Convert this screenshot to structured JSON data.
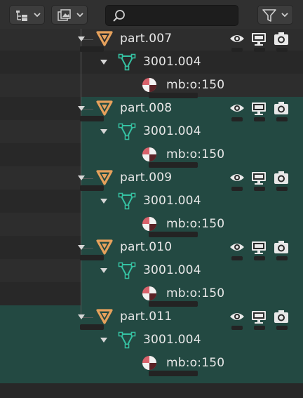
{
  "header": {
    "display_mode_icon": "outliner-tree-icon",
    "filter_icon": "filter-funnel-icon",
    "search": {
      "placeholder": "",
      "value": ""
    }
  },
  "colors": {
    "selected_row": "#234942",
    "object_icon": "#e6a15c",
    "mesh_icon": "#35c1a2",
    "material_icon": "#d9626c"
  },
  "objects": [
    {
      "name": "part.007",
      "mesh": "3001.004",
      "material": "mb:o:150",
      "selected": false
    },
    {
      "name": "part.008",
      "mesh": "3001.004",
      "material": "mb:o:150",
      "selected": true
    },
    {
      "name": "part.009",
      "mesh": "3001.004",
      "material": "mb:o:150",
      "selected": true
    },
    {
      "name": "part.010",
      "mesh": "3001.004",
      "material": "mb:o:150",
      "selected": true
    },
    {
      "name": "part.011",
      "mesh": "3001.004",
      "material": "mb:o:150",
      "selected": true
    }
  ]
}
